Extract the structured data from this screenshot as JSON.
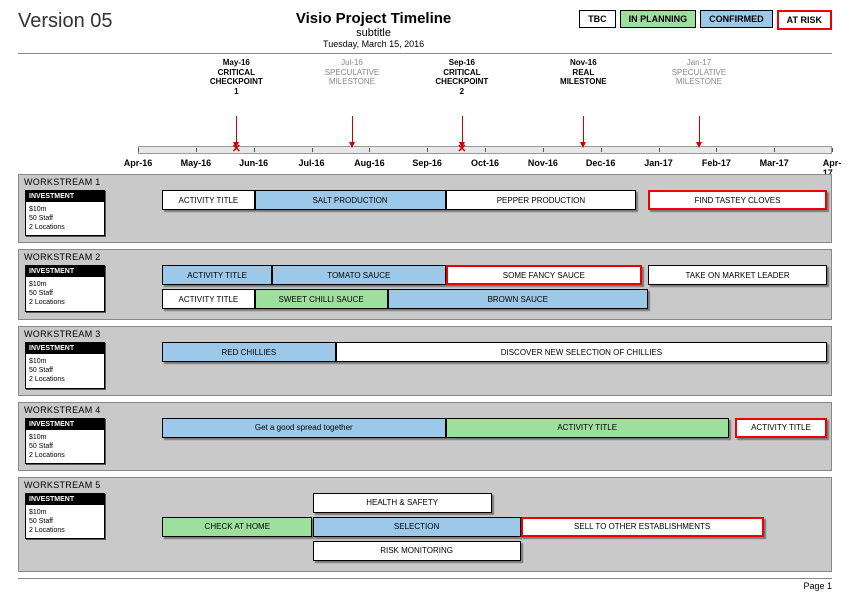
{
  "header": {
    "version": "Version 05",
    "title": "Visio Project Timeline",
    "subtitle": "subtitle",
    "date": "Tuesday, March 15, 2016"
  },
  "legend": {
    "tbc": "TBC",
    "planning": "IN PLANNING",
    "confirmed": "CONFIRMED",
    "risk": "AT RISK"
  },
  "axis": {
    "start_index": 0,
    "ticks": [
      "Apr-16",
      "May-16",
      "Jun-16",
      "Jul-16",
      "Aug-16",
      "Sep-16",
      "Oct-16",
      "Nov-16",
      "Dec-16",
      "Jan-17",
      "Feb-17",
      "Mar-17",
      "Apr-17"
    ]
  },
  "milestones": [
    {
      "month_index": 1.7,
      "lines": [
        "May-16",
        "CRITICAL",
        "CHECKPOINT",
        "1"
      ],
      "style": "strong",
      "marker": "x"
    },
    {
      "month_index": 3.7,
      "lines": [
        "Jul-16",
        "SPECULATIVE",
        "MILESTONE"
      ],
      "style": "weak",
      "marker": "arrow"
    },
    {
      "month_index": 5.6,
      "lines": [
        "Sep-16",
        "CRITICAL",
        "CHECKPOINT",
        "2"
      ],
      "style": "strong",
      "marker": "x"
    },
    {
      "month_index": 7.7,
      "lines": [
        "Nov-16",
        "REAL",
        "MILESTONE"
      ],
      "style": "strong",
      "marker": "arrow"
    },
    {
      "month_index": 9.7,
      "lines": [
        "Jan-17",
        "SPECULATIVE",
        "MILESTONE"
      ],
      "style": "weak",
      "marker": "arrow"
    }
  ],
  "investment": {
    "head": "INVESTMENT",
    "line1": "$10m",
    "line2": "50 Staff",
    "line3": "2 Locations"
  },
  "workstreams": [
    {
      "title": "WORKSTREAM 1",
      "rows": [
        [
          {
            "label": "ACTIVITY TITLE",
            "status": "tbc",
            "start": 0.4,
            "end": 2.0
          },
          {
            "label": "SALT PRODUCTION",
            "status": "confirmed",
            "start": 2.0,
            "end": 5.3
          },
          {
            "label": "PEPPER PRODUCTION",
            "status": "tbc",
            "start": 5.3,
            "end": 8.6
          },
          {
            "label": "FIND TASTEY CLOVES",
            "status": "risk",
            "start": 8.8,
            "end": 11.9
          }
        ]
      ]
    },
    {
      "title": "WORKSTREAM 2",
      "rows": [
        [
          {
            "label": "ACTIVITY TITLE",
            "status": "confirmed",
            "start": 0.4,
            "end": 2.3
          },
          {
            "label": "TOMATO SAUCE",
            "status": "confirmed",
            "start": 2.3,
            "end": 5.3
          },
          {
            "label": "SOME FANCY SAUCE",
            "status": "risk",
            "start": 5.3,
            "end": 8.7
          },
          {
            "label": "TAKE ON MARKET LEADER",
            "status": "tbc",
            "start": 8.8,
            "end": 11.9
          }
        ],
        [
          {
            "label": "ACTIVITY TITLE",
            "status": "tbc",
            "start": 0.4,
            "end": 2.0
          },
          {
            "label": "SWEET CHILLI SAUCE",
            "status": "planning",
            "start": 2.0,
            "end": 4.3
          },
          {
            "label": "BROWN SAUCE",
            "status": "confirmed",
            "start": 4.3,
            "end": 8.8
          }
        ]
      ]
    },
    {
      "title": "WORKSTREAM 3",
      "rows": [
        [
          {
            "label": "RED CHILLIES",
            "status": "confirmed",
            "start": 0.4,
            "end": 3.4
          },
          {
            "label": "DISCOVER NEW SELECTION OF CHILLIES",
            "status": "tbc",
            "start": 3.4,
            "end": 11.9
          }
        ]
      ]
    },
    {
      "title": "WORKSTREAM 4",
      "rows": [
        [
          {
            "label": "Get a good spread together",
            "status": "confirmed",
            "start": 0.4,
            "end": 5.3
          },
          {
            "label": "ACTIVITY TITLE",
            "status": "planning",
            "start": 5.3,
            "end": 10.2
          },
          {
            "label": "ACTIVITY TITLE",
            "status": "risk",
            "start": 10.3,
            "end": 11.9
          }
        ]
      ]
    },
    {
      "title": "WORKSTREAM 5",
      "rows": [
        [
          {
            "label": "HEALTH & SAFETY",
            "status": "tbc",
            "start": 3.0,
            "end": 6.1
          }
        ],
        [
          {
            "label": "CHECK AT HOME",
            "status": "planning",
            "start": 0.4,
            "end": 3.0
          },
          {
            "label": "SELECTION",
            "status": "confirmed",
            "start": 3.0,
            "end": 6.6
          },
          {
            "label": "SELL TO OTHER ESTABLISHMENTS",
            "status": "risk",
            "start": 6.6,
            "end": 10.8
          }
        ],
        [
          {
            "label": "RISK MONITORING",
            "status": "tbc",
            "start": 3.0,
            "end": 6.6
          }
        ]
      ]
    }
  ],
  "footer": {
    "page": "Page 1"
  }
}
